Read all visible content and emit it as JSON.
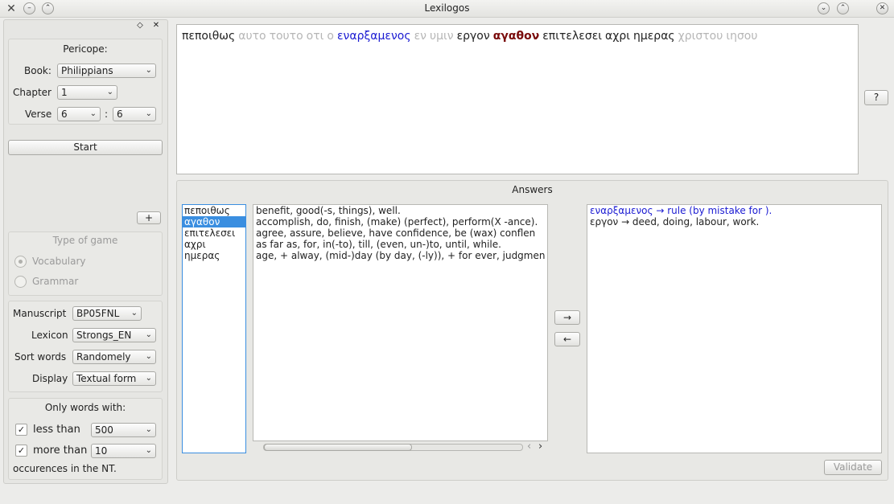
{
  "window": {
    "title": "Lexilogos"
  },
  "sidebar": {
    "pericope_title": "Pericope:",
    "book_label": "Book:",
    "book_value": "Philippians",
    "chapter_label": "Chapter",
    "chapter_value": "1",
    "verse_label": "Verse",
    "verse_from": "6",
    "verse_sep": ":",
    "verse_to": "6",
    "start_label": "Start",
    "add_label": "+",
    "game_type_title": "Type of game",
    "vocabulary_label": "Vocabulary",
    "grammar_label": "Grammar",
    "manuscript_label": "Manuscript",
    "manuscript_value": "BP05FNL",
    "lexicon_label": "Lexicon",
    "lexicon_value": "Strongs_EN",
    "sort_label": "Sort words",
    "sort_value": "Randomely",
    "display_label": "Display",
    "display_value": "Textual form",
    "only_words_title": "Only words with:",
    "less_than_label": "less than",
    "less_than_value": "500",
    "more_than_label": "more than",
    "more_than_value": "10",
    "occurences_label": "occurences in the NT."
  },
  "pericope": {
    "words": [
      {
        "text": "πεποιθως",
        "style": "normal"
      },
      {
        "text": "αυτο",
        "style": "gray"
      },
      {
        "text": "τουτο",
        "style": "gray"
      },
      {
        "text": "οτι",
        "style": "gray"
      },
      {
        "text": "ο",
        "style": "gray"
      },
      {
        "text": "εναρξαμενος",
        "style": "blue"
      },
      {
        "text": "εν",
        "style": "gray"
      },
      {
        "text": "υμιν",
        "style": "gray"
      },
      {
        "text": "εργον",
        "style": "normal"
      },
      {
        "text": "αγαθον",
        "style": "bold"
      },
      {
        "text": "επιτελεσει",
        "style": "normal"
      },
      {
        "text": "αχρι",
        "style": "normal"
      },
      {
        "text": "ημερας",
        "style": "normal"
      },
      {
        "text": "χριστου",
        "style": "gray"
      },
      {
        "text": "ιησου",
        "style": "gray"
      }
    ],
    "help_label": "?"
  },
  "answers": {
    "title": "Answers",
    "words": [
      "πεποιθως",
      "αγαθον",
      "επιτελεσει",
      "αχρι",
      "ημερας"
    ],
    "selected_index": 1,
    "glosses": [
      "benefit, good(-s, things), well.",
      "accomplish, do, finish, (make) (perfect), perform(X -ance).",
      "agree, assure, believe, have confidence, be (wax) conflen",
      "as far as, for, in(-to), till, (even, un-)to, until, while.",
      "age, + alway, (mid-)day (by day, (-ly)), + for ever, judgmen"
    ],
    "move_right_label": "→",
    "move_left_label": "←",
    "scroll_left_label": "‹",
    "scroll_right_label": "›",
    "results": [
      {
        "text": "εναρξαμενος → rule (by mistake for ).",
        "style": "blue"
      },
      {
        "text": "εργον → deed, doing, labour, work.",
        "style": "normal"
      }
    ],
    "validate_label": "Validate"
  },
  "icons": {
    "app": "✕",
    "window_menu": "–",
    "shade": "⌃",
    "minimize": "⌄",
    "maximize": "⌃",
    "close": "✕",
    "dock_float": "◇",
    "dock_close": "✕",
    "check": "✓",
    "combo_arrow": "⌄"
  }
}
